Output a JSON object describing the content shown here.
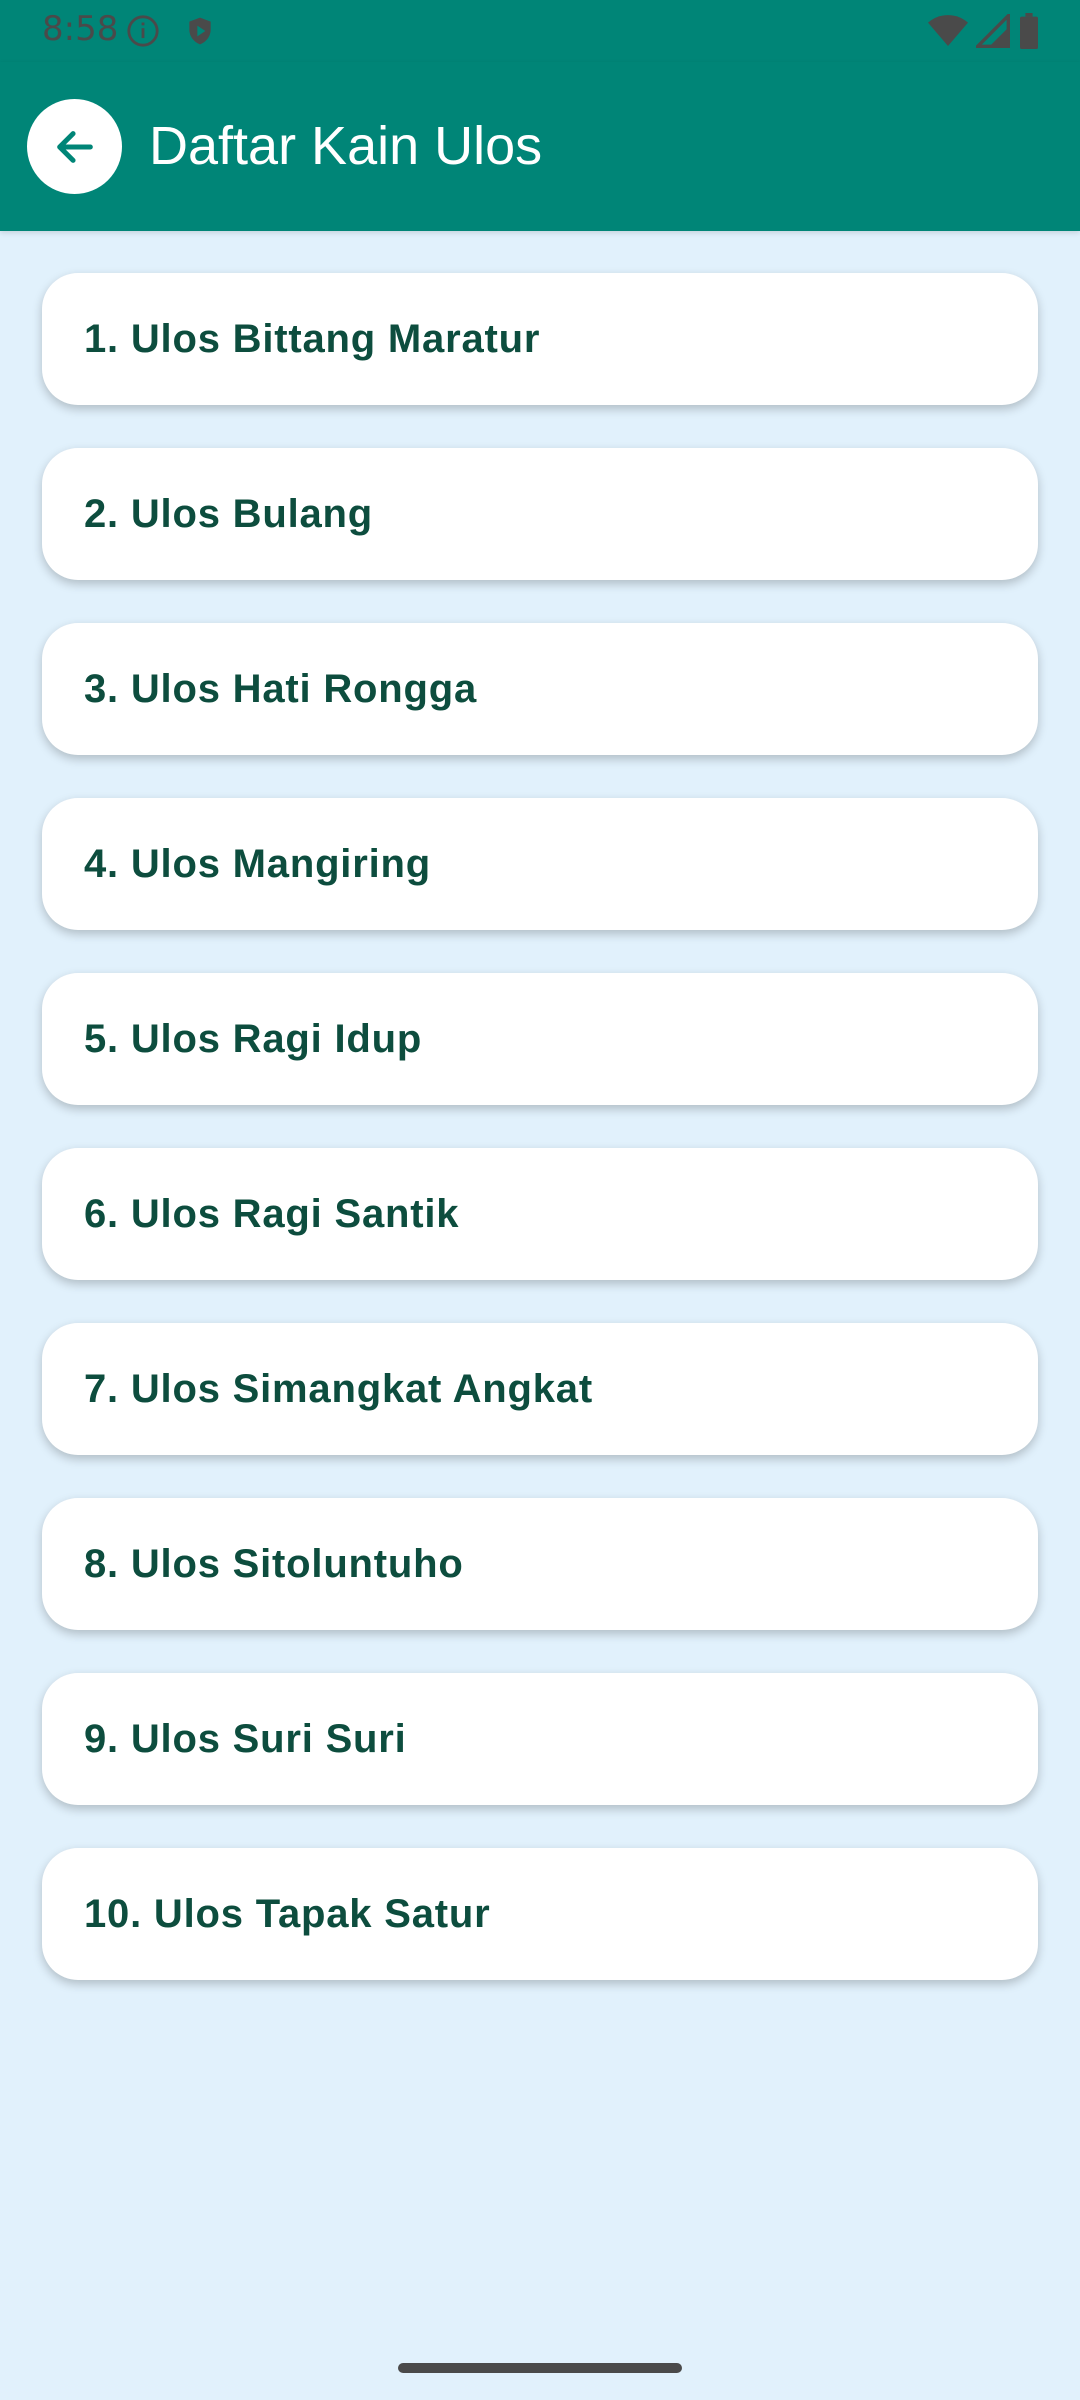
{
  "status_bar": {
    "time": "8:58",
    "icons": [
      "info-icon",
      "shield-icon",
      "wifi-icon",
      "signal-icon",
      "battery-icon"
    ],
    "background": "#008577"
  },
  "app_bar": {
    "title": "Daftar Kain Ulos",
    "back_icon": "arrow-left-icon",
    "background": "#008577"
  },
  "list": {
    "items": [
      {
        "label": "1. Ulos Bittang Maratur"
      },
      {
        "label": "2. Ulos Bulang"
      },
      {
        "label": "3. Ulos Hati Rongga"
      },
      {
        "label": "4. Ulos Mangiring"
      },
      {
        "label": "5. Ulos Ragi Idup"
      },
      {
        "label": "6. Ulos Ragi Santik"
      },
      {
        "label": "7. Ulos Simangkat Angkat"
      },
      {
        "label": "8. Ulos Sitoluntuho"
      },
      {
        "label": "9. Ulos Suri Suri"
      },
      {
        "label": "10. Ulos Tapak Satur"
      }
    ]
  },
  "colors": {
    "primary": "#008577",
    "page_background": "#e1f1fc",
    "item_text": "#0d4d3e",
    "card_background": "#ffffff"
  }
}
